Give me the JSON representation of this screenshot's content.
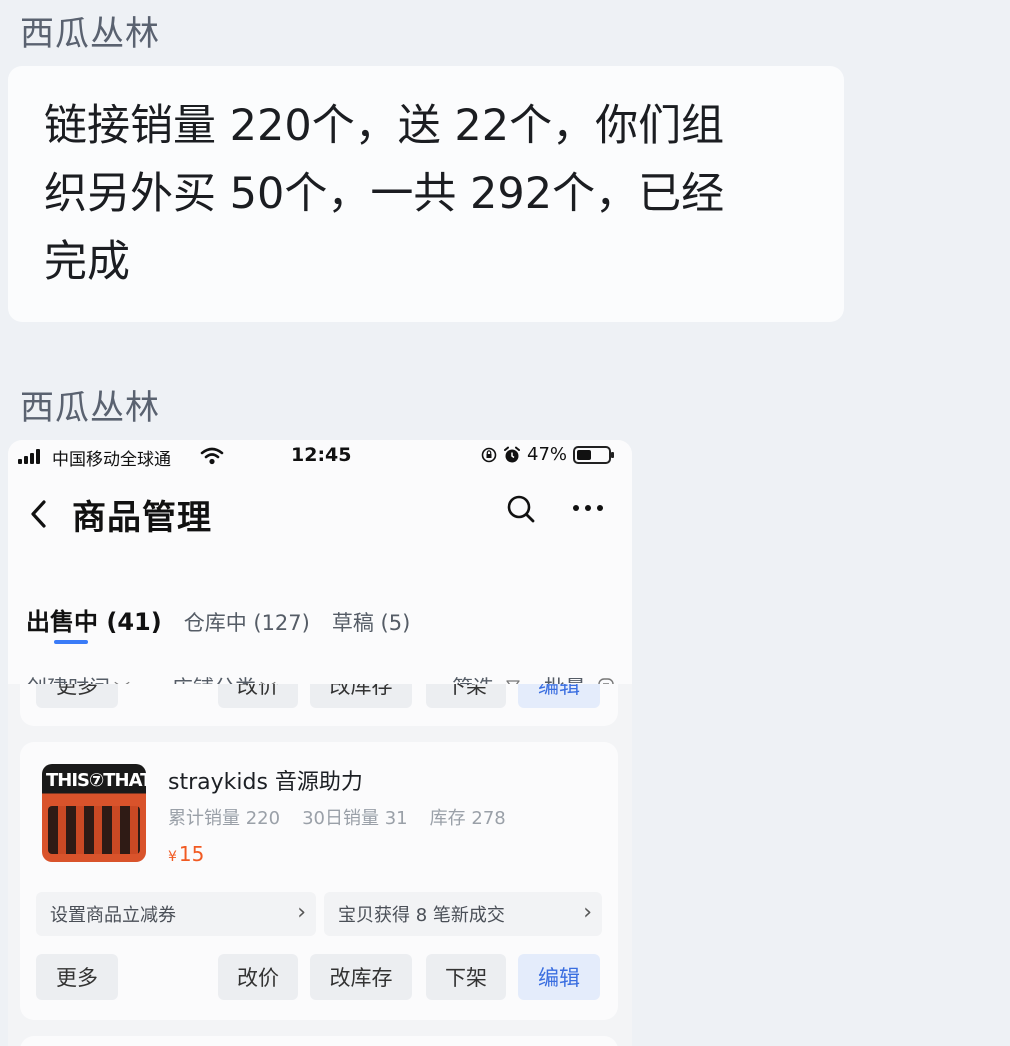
{
  "chat": {
    "sender1": "西瓜丛林",
    "message_lines": [
      "链接销量 220个，送 22个，你们组",
      "织另外买 50个，一共 292个，已经",
      "完成"
    ],
    "sender2": "西瓜丛林"
  },
  "phone": {
    "status": {
      "carrier": "中国移动全球通",
      "time": "12:45",
      "battery": "47%",
      "battery_level": 0.47
    },
    "header": {
      "back_icon": "chevron-left-icon",
      "title": "商品管理",
      "search_icon": "search-icon",
      "more_icon": "more-dots-icon"
    },
    "tabs": [
      {
        "label": "出售中 (41)",
        "active": true
      },
      {
        "label": "仓库中 (127)",
        "active": false
      },
      {
        "label": "草稿 (5)",
        "active": false
      }
    ],
    "filters": {
      "created_time": "创建时间",
      "shop_category": "店铺分类",
      "filter": "筛选",
      "batch": "批量"
    },
    "prev_card_actions": {
      "more": "更多",
      "change_price": "改价",
      "change_stock": "改库存",
      "delist": "下架",
      "edit": "编辑"
    },
    "product": {
      "name": "straykids 音源助力",
      "thumb_text": "THIS⑦THAT",
      "total_sales_label": "累计销量",
      "total_sales": "220",
      "sales30_label": "30日销量",
      "sales30": "31",
      "stock_label": "库存",
      "stock": "278",
      "currency": "¥",
      "price": "15",
      "promo1": "设置商品立减券",
      "promo2": "宝贝获得 8 笔新成交",
      "actions": {
        "more": "更多",
        "change_price": "改价",
        "change_stock": "改库存",
        "delist": "下架",
        "edit": "编辑"
      }
    }
  },
  "colors": {
    "accent": "#3a7bf7",
    "price": "#f15a22",
    "page_bg": "#eef1f5"
  }
}
